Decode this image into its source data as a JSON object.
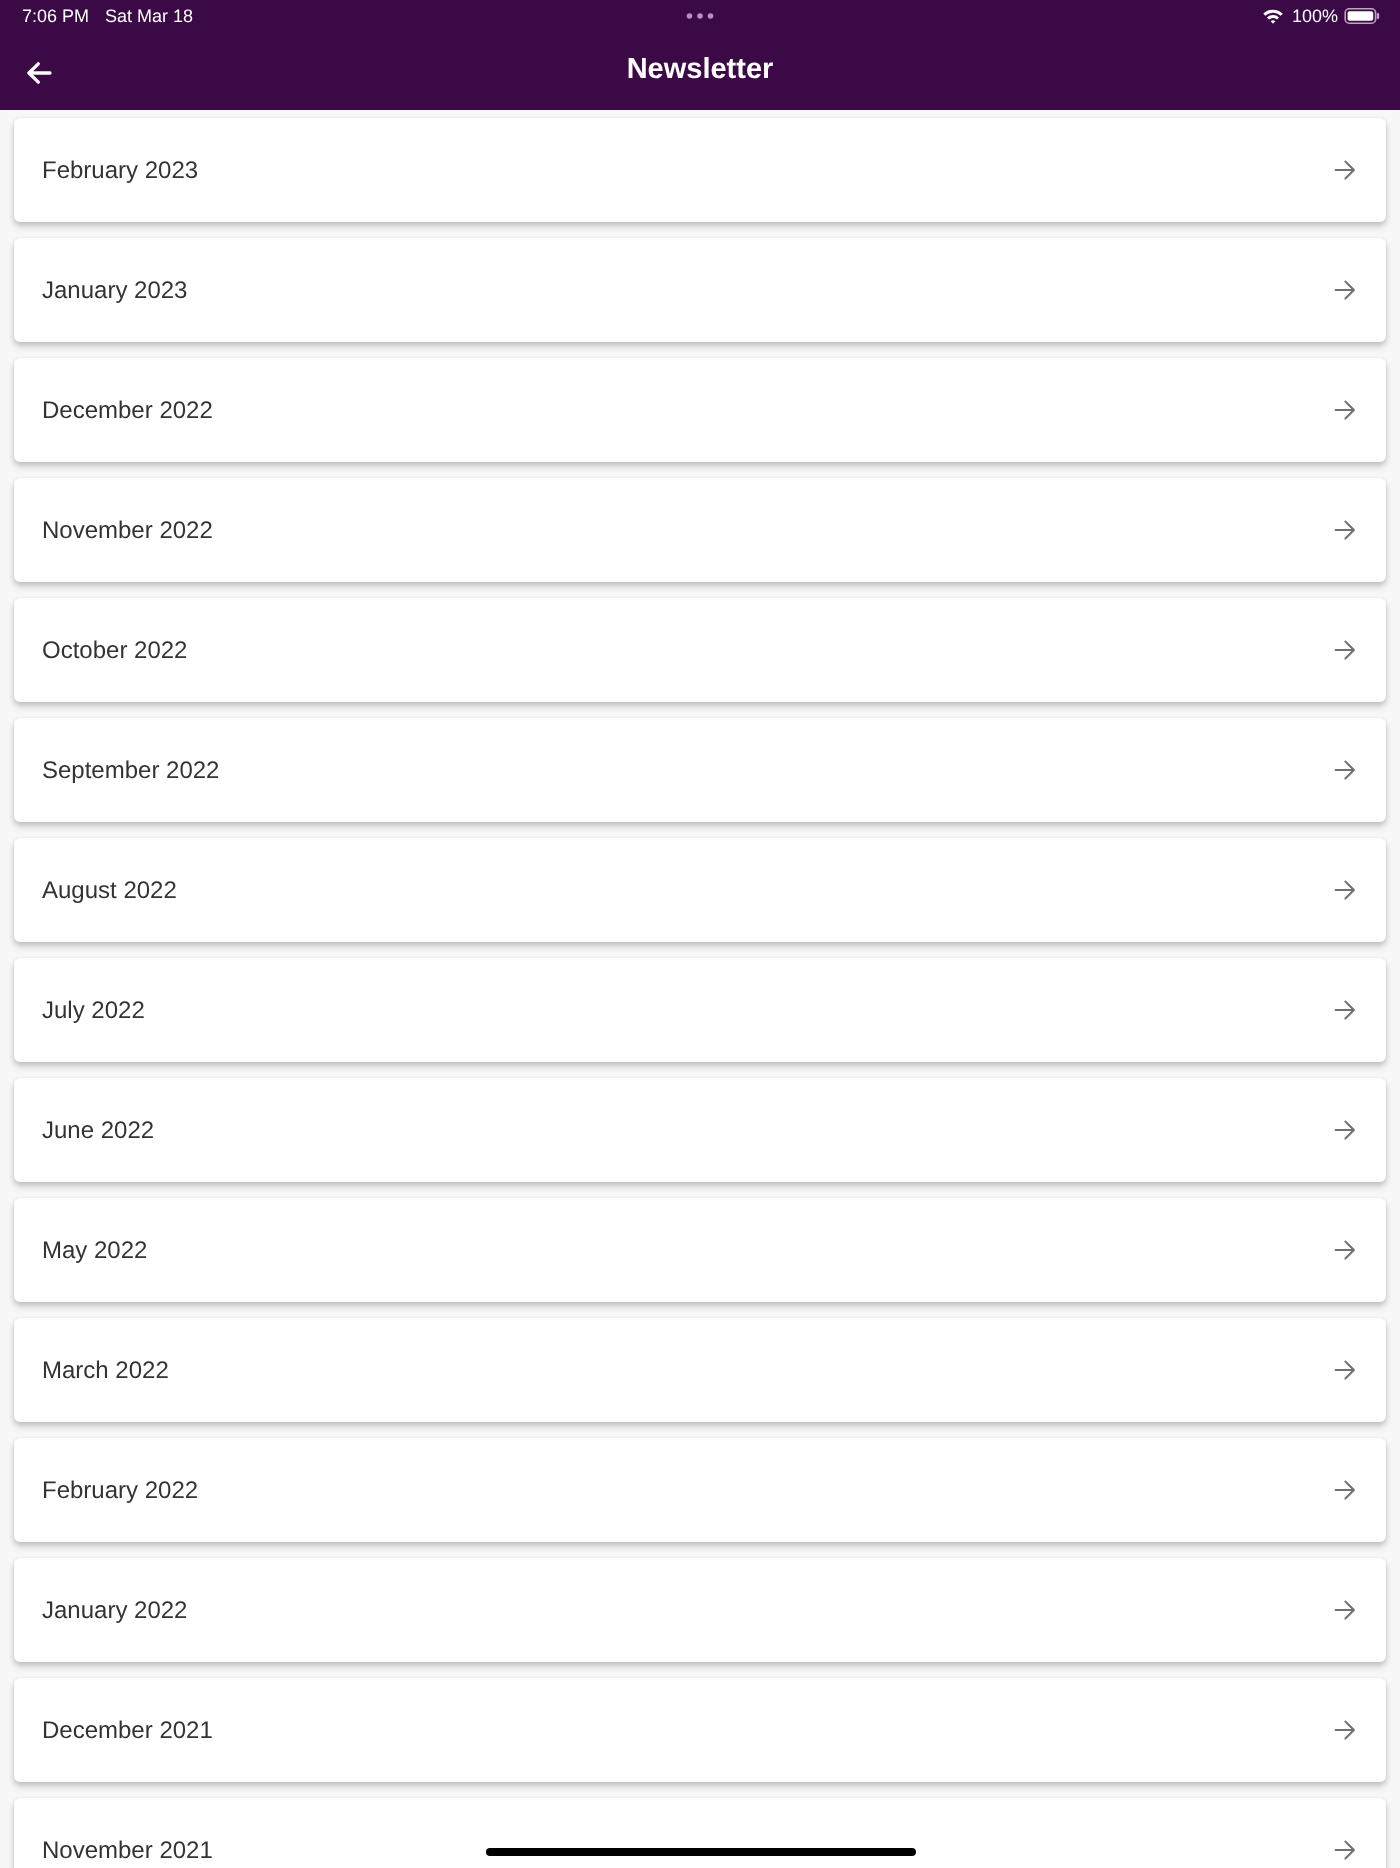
{
  "status_bar": {
    "time": "7:06 PM",
    "date": "Sat Mar 18",
    "battery": "100%"
  },
  "header": {
    "title": "Newsletter"
  },
  "items": [
    {
      "label": "February 2023"
    },
    {
      "label": "January 2023"
    },
    {
      "label": "December 2022"
    },
    {
      "label": "November 2022"
    },
    {
      "label": "October 2022"
    },
    {
      "label": "September 2022"
    },
    {
      "label": "August 2022"
    },
    {
      "label": "July 2022"
    },
    {
      "label": "June 2022"
    },
    {
      "label": "May 2022"
    },
    {
      "label": "March 2022"
    },
    {
      "label": "February 2022"
    },
    {
      "label": "January 2022"
    },
    {
      "label": "December 2021"
    },
    {
      "label": "November 2021"
    }
  ]
}
